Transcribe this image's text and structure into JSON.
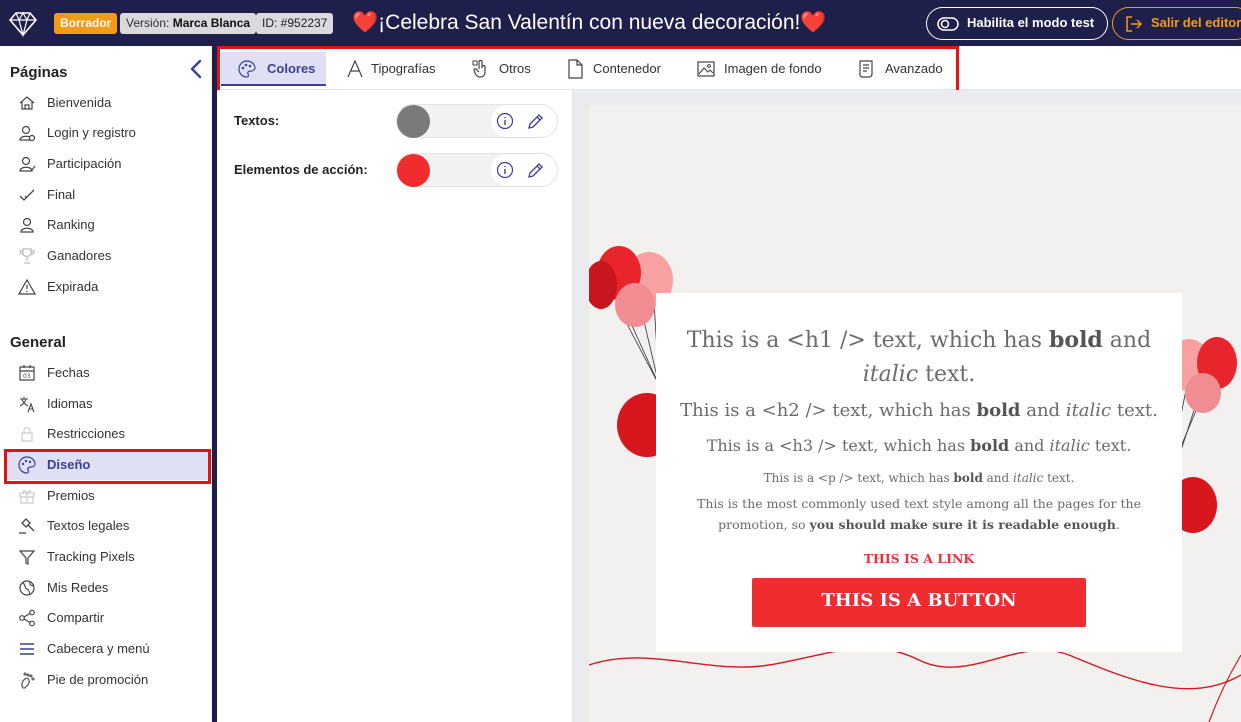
{
  "topbar": {
    "badges": {
      "draft": "Borrador",
      "version_prefix": "Versión:",
      "version_value": "Marca Blanca",
      "id": "ID: #952237"
    },
    "title": "¡Celebra San Valentín con nueva decoración!",
    "heart": "❤️",
    "test_mode_label": "Habilita el modo test",
    "exit_label": "Salir del editor"
  },
  "sidebar": {
    "pages_title": "Páginas",
    "pages": [
      {
        "label": "Bienvenida",
        "icon": "home-icon"
      },
      {
        "label": "Login y registro",
        "icon": "user-login-icon"
      },
      {
        "label": "Participación",
        "icon": "user-participation-icon"
      },
      {
        "label": "Final",
        "icon": "check-icon"
      },
      {
        "label": "Ranking",
        "icon": "ranking-icon"
      },
      {
        "label": "Ganadores",
        "icon": "trophy-icon"
      },
      {
        "label": "Expirada",
        "icon": "warning-icon"
      }
    ],
    "general_title": "General",
    "general": [
      {
        "label": "Fechas",
        "icon": "calendar-icon"
      },
      {
        "label": "Idiomas",
        "icon": "translate-icon"
      },
      {
        "label": "Restricciones",
        "icon": "lock-icon"
      },
      {
        "label": "Diseño",
        "icon": "palette-icon",
        "active": true
      },
      {
        "label": "Premios",
        "icon": "gift-icon"
      },
      {
        "label": "Textos legales",
        "icon": "gavel-icon"
      },
      {
        "label": "Tracking Pixels",
        "icon": "filter-icon"
      },
      {
        "label": "Mis Redes",
        "icon": "globe-icon"
      },
      {
        "label": "Compartir",
        "icon": "share-icon"
      },
      {
        "label": "Cabecera y menú",
        "icon": "menu-icon"
      },
      {
        "label": "Pie de promoción",
        "icon": "footprint-icon"
      }
    ]
  },
  "tabs": [
    {
      "label": "Colores",
      "icon": "palette-icon",
      "active": true
    },
    {
      "label": "Tipografías",
      "icon": "font-icon"
    },
    {
      "label": "Otros",
      "icon": "pointer-icon"
    },
    {
      "label": "Contenedor",
      "icon": "page-icon"
    },
    {
      "label": "Imagen de fondo",
      "icon": "image-icon"
    },
    {
      "label": "Avanzado",
      "icon": "advanced-icon"
    }
  ],
  "panel": {
    "fields": [
      {
        "label": "Textos:",
        "color": "#7a7a7a"
      },
      {
        "label": "Elementos de acción:",
        "color": "#f02c2f"
      }
    ]
  },
  "preview": {
    "h1": {
      "pre": "This is a <h1 /> text, which has ",
      "bold": "bold",
      "mid": " and ",
      "italic": "italic",
      "post": " text."
    },
    "h2": {
      "pre": "This is a <h2 /> text, which has ",
      "bold": "bold",
      "mid": " and ",
      "italic": "italic",
      "post": " text."
    },
    "h3": {
      "pre": "This is a <h3 /> text, which has ",
      "bold": "bold",
      "mid": " and ",
      "italic": "italic",
      "post": " text."
    },
    "p": {
      "pre": "This is a <p /> text, which has ",
      "bold": "bold",
      "mid": " and ",
      "italic": "italic",
      "post": " text."
    },
    "p2": {
      "pre": "This is the most commonly used text style among all the pages for the promotion, so ",
      "bold": "you should make sure it is readable enough",
      "post": "."
    },
    "link": "THIS IS A LINK",
    "button": "THIS IS A BUTTON"
  }
}
